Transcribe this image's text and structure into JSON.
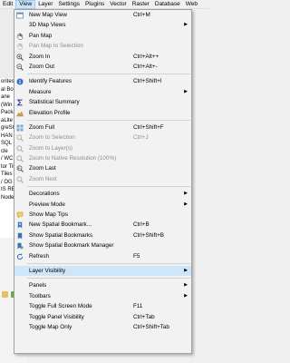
{
  "menubar": [
    {
      "label": "Edit",
      "active": false
    },
    {
      "label": "View",
      "active": true
    },
    {
      "label": "Layer",
      "active": false
    },
    {
      "label": "Settings",
      "active": false
    },
    {
      "label": "Plugins",
      "active": false
    },
    {
      "label": "Vector",
      "active": false
    },
    {
      "label": "Raster",
      "active": false
    },
    {
      "label": "Database",
      "active": false
    },
    {
      "label": "Web",
      "active": false
    }
  ],
  "background_layers": [
    "orites",
    "al Bo",
    "ane",
    "(Win",
    "Packa",
    "aLite",
    "greSQ",
    "HAN",
    "SQL S",
    "cle",
    "/ WC",
    "tor Til",
    "Tiles",
    "/ OG",
    "IS RE",
    "Node"
  ],
  "view_menu": {
    "items": [
      {
        "type": "item",
        "label": "New Map View",
        "shortcut": "Ctrl+M",
        "icon": "new-map-view-icon",
        "disabled": false,
        "submenu": false
      },
      {
        "type": "item",
        "label": "3D Map Views",
        "shortcut": "",
        "icon": "",
        "disabled": false,
        "submenu": true
      },
      {
        "type": "item",
        "label": "Pan Map",
        "shortcut": "",
        "icon": "pan-icon",
        "disabled": false,
        "submenu": false
      },
      {
        "type": "item",
        "label": "Pan Map to Selection",
        "shortcut": "",
        "icon": "pan-selection-icon",
        "disabled": true,
        "submenu": false
      },
      {
        "type": "item",
        "label": "Zoom In",
        "shortcut": "Ctrl+Alt++",
        "icon": "zoom-in-icon",
        "disabled": false,
        "submenu": false
      },
      {
        "type": "item",
        "label": "Zoom Out",
        "shortcut": "Ctrl+Alt+-",
        "icon": "zoom-out-icon",
        "disabled": false,
        "submenu": false
      },
      {
        "type": "separator"
      },
      {
        "type": "item",
        "label": "Identify Features",
        "shortcut": "Ctrl+Shift+I",
        "icon": "identify-icon",
        "disabled": false,
        "submenu": false
      },
      {
        "type": "item",
        "label": "Measure",
        "shortcut": "",
        "icon": "",
        "disabled": false,
        "submenu": true
      },
      {
        "type": "item",
        "label": "Statistical Summary",
        "shortcut": "",
        "icon": "sigma-icon",
        "disabled": false,
        "submenu": false
      },
      {
        "type": "item",
        "label": "Elevation Profile",
        "shortcut": "",
        "icon": "elevation-icon",
        "disabled": false,
        "submenu": false
      },
      {
        "type": "separator"
      },
      {
        "type": "item",
        "label": "Zoom Full",
        "shortcut": "Ctrl+Shift+F",
        "icon": "zoom-full-icon",
        "disabled": false,
        "submenu": false
      },
      {
        "type": "item",
        "label": "Zoom to Selection",
        "shortcut": "Ctrl+J",
        "icon": "zoom-selection-icon",
        "disabled": true,
        "submenu": false
      },
      {
        "type": "item",
        "label": "Zoom to Layer(s)",
        "shortcut": "",
        "icon": "zoom-layer-icon",
        "disabled": true,
        "submenu": false
      },
      {
        "type": "item",
        "label": "Zoom to Native Resolution (100%)",
        "shortcut": "",
        "icon": "zoom-native-icon",
        "disabled": true,
        "submenu": false
      },
      {
        "type": "item",
        "label": "Zoom Last",
        "shortcut": "",
        "icon": "zoom-last-icon",
        "disabled": false,
        "submenu": false
      },
      {
        "type": "item",
        "label": "Zoom Next",
        "shortcut": "",
        "icon": "zoom-next-icon",
        "disabled": true,
        "submenu": false
      },
      {
        "type": "separator"
      },
      {
        "type": "item",
        "label": "Decorations",
        "shortcut": "",
        "icon": "",
        "disabled": false,
        "submenu": true
      },
      {
        "type": "item",
        "label": "Preview Mode",
        "shortcut": "",
        "icon": "",
        "disabled": false,
        "submenu": true
      },
      {
        "type": "item",
        "label": "Show Map Tips",
        "shortcut": "",
        "icon": "map-tips-icon",
        "disabled": false,
        "submenu": false
      },
      {
        "type": "item",
        "label": "New Spatial Bookmark...",
        "shortcut": "Ctrl+B",
        "icon": "new-bookmark-icon",
        "disabled": false,
        "submenu": false
      },
      {
        "type": "item",
        "label": "Show Spatial Bookmarks",
        "shortcut": "Ctrl+Shift+B",
        "icon": "bookmarks-icon",
        "disabled": false,
        "submenu": false
      },
      {
        "type": "item",
        "label": "Show Spatial Bookmark Manager",
        "shortcut": "",
        "icon": "bookmark-manager-icon",
        "disabled": false,
        "submenu": false
      },
      {
        "type": "item",
        "label": "Refresh",
        "shortcut": "F5",
        "icon": "refresh-icon",
        "disabled": false,
        "submenu": false
      },
      {
        "type": "separator"
      },
      {
        "type": "item",
        "label": "Layer Visibility",
        "shortcut": "",
        "icon": "",
        "disabled": false,
        "submenu": true,
        "highlighted": true
      },
      {
        "type": "separator"
      },
      {
        "type": "item",
        "label": "Panels",
        "shortcut": "",
        "icon": "",
        "disabled": false,
        "submenu": true
      },
      {
        "type": "item",
        "label": "Toolbars",
        "shortcut": "",
        "icon": "",
        "disabled": false,
        "submenu": true
      },
      {
        "type": "item",
        "label": "Toggle Full Screen Mode",
        "shortcut": "F11",
        "icon": "",
        "disabled": false,
        "submenu": false
      },
      {
        "type": "item",
        "label": "Toggle Panel Visibility",
        "shortcut": "Ctrl+Tab",
        "icon": "",
        "disabled": false,
        "submenu": false
      },
      {
        "type": "item",
        "label": "Toggle Map Only",
        "shortcut": "Ctrl+Shift+Tab",
        "icon": "",
        "disabled": false,
        "submenu": false
      }
    ]
  }
}
